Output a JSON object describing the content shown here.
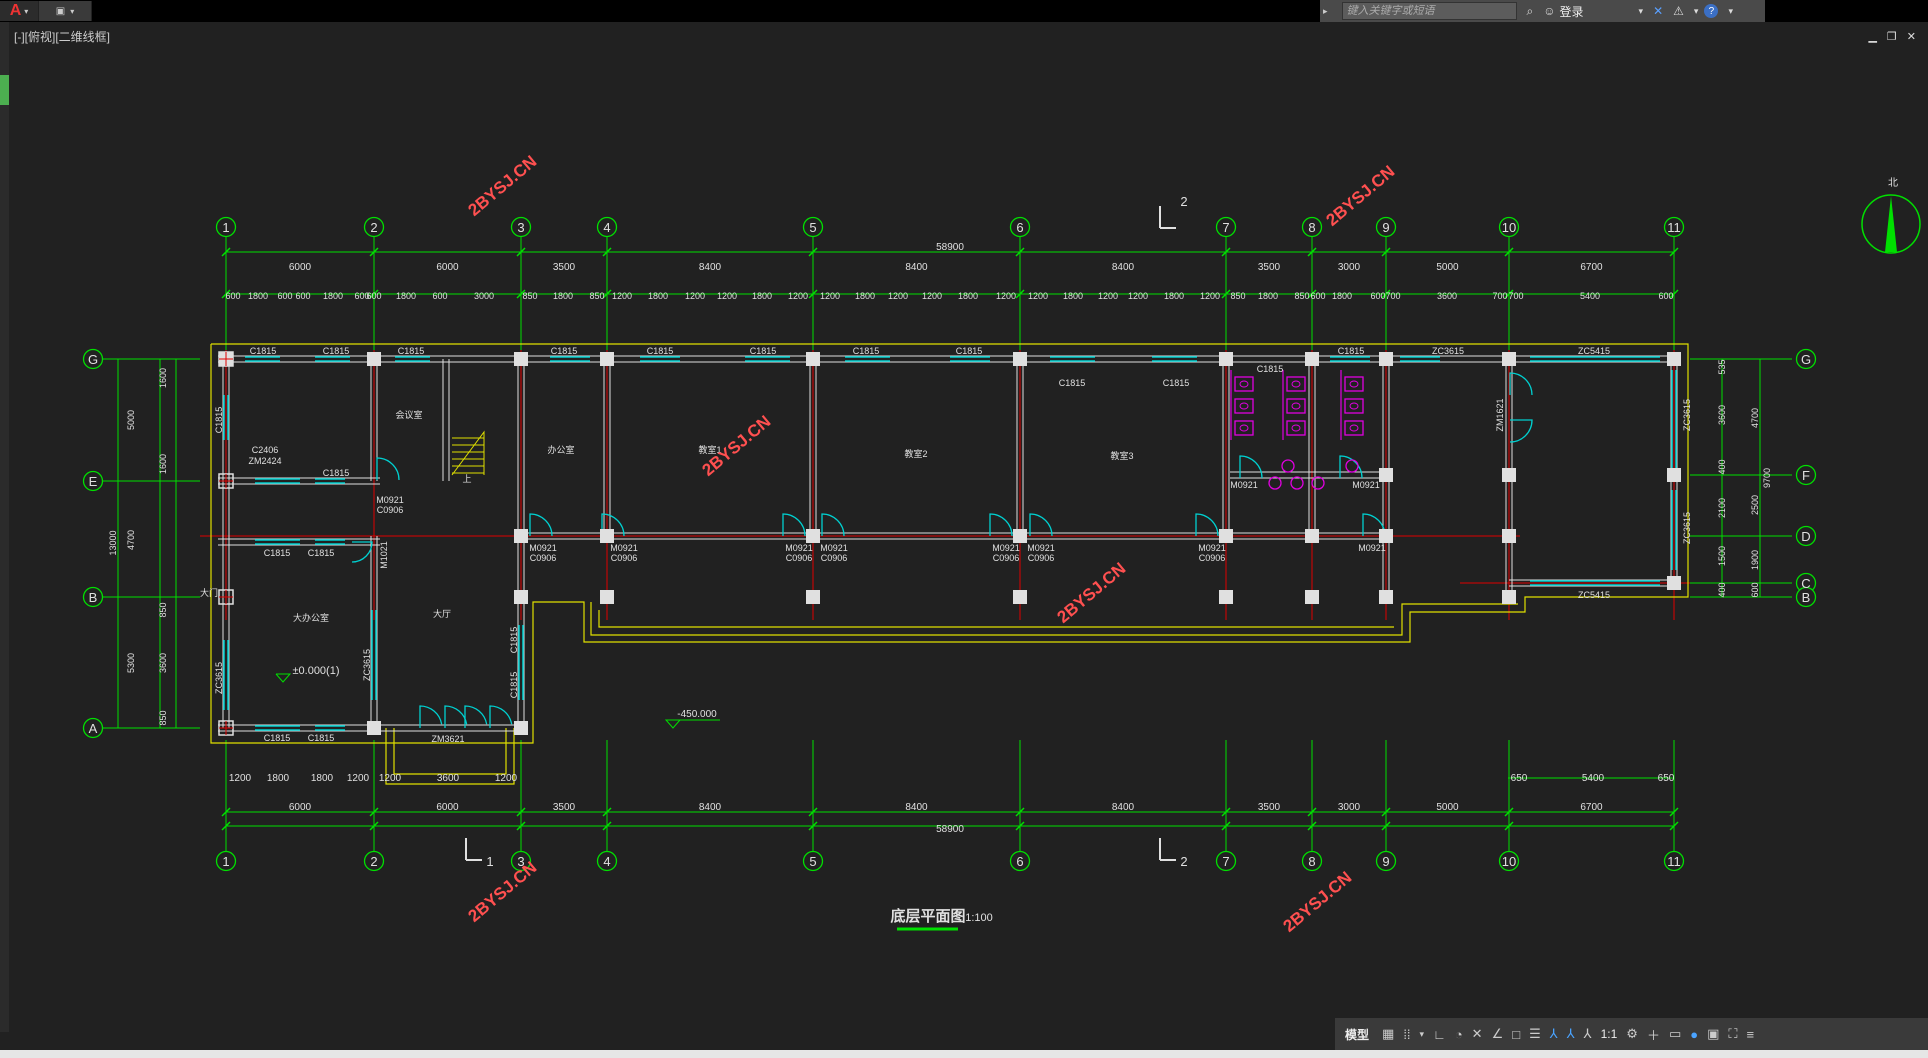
{
  "app": {
    "logo": "A",
    "search_placeholder": "键入关键字或短语",
    "login_label": "登录",
    "help": "?",
    "viewport_label": "[-][俯视][二维线框]"
  },
  "status": {
    "model_tab": "模型",
    "scale": "1:1"
  },
  "colors": {
    "background": "#212121",
    "axis_green": "#00e000",
    "wall_white": "#e0e0e0",
    "window_cyan": "#00d0d0",
    "red_line": "#e00000",
    "yellow": "#e0e000",
    "magenta": "#e000e0",
    "watermark": "#ff5050"
  },
  "drawing": {
    "title": "底层平面图",
    "scale": "1:100",
    "north_label": "北",
    "grid_cols": [
      "1",
      "2",
      "3",
      "4",
      "5",
      "6",
      "7",
      "8",
      "9",
      "10",
      "11"
    ],
    "grid_rows": [
      "G",
      "E",
      "B",
      "A",
      "G",
      "F",
      "D",
      "C",
      "B"
    ],
    "overall_dim": "58900",
    "top_dims": [
      "6000",
      "6000",
      "3500",
      "8400",
      "8400",
      "8400",
      "3500",
      "3000",
      "5000",
      "6700"
    ],
    "top_sub_dims": [
      "600",
      "1800",
      "600",
      "600",
      "1800",
      "600",
      "600",
      "1800",
      "600",
      "3000",
      "850",
      "1800",
      "850",
      "1200",
      "1800",
      "1200",
      "1200",
      "1800",
      "1200",
      "1200",
      "1800",
      "1200",
      "1200",
      "1800",
      "1200",
      "1200",
      "1800",
      "1200",
      "1200",
      "1800",
      "1200",
      "850",
      "1800",
      "850",
      "600",
      "1800",
      "600",
      "700",
      "3600",
      "700",
      "700",
      "5400",
      "600"
    ],
    "bottom_sub_dims": [
      "1200",
      "1800",
      "1800",
      "1200",
      "1200",
      "3600",
      "1200",
      "650",
      "5400",
      "650"
    ],
    "left_dims": [
      "1600",
      "1600",
      "5000",
      "4700",
      "850",
      "5300",
      "3600",
      "850",
      "13000"
    ],
    "right_dims": [
      "535",
      "3600",
      "4700",
      "400",
      "2100",
      "2500",
      "9700",
      "1500",
      "1900",
      "400",
      "600"
    ],
    "section_marks": [
      "2",
      "1",
      "2"
    ],
    "watermark": "2BYSJ.CN",
    "level_mark_1": "±0.000(1)",
    "level_mark_2": "-450.000",
    "labels": {
      "c1815": "C1815",
      "zc3615": "ZC3615",
      "zc5415": "ZC5415",
      "zm3621": "ZM3621",
      "zm1621": "ZM1621",
      "m0921": "M0921",
      "c0906": "C0906",
      "m1021": "M1021",
      "c2406": "C2406",
      "zm2424": "ZM2424",
      "room_1": "办公室",
      "room_2": "教室1",
      "room_3": "教室2",
      "room_4": "教室3",
      "room_5": "大办公室",
      "room_6": "大厅",
      "room_7": "会议室",
      "stair_up": "上",
      "entry": "大门"
    }
  }
}
